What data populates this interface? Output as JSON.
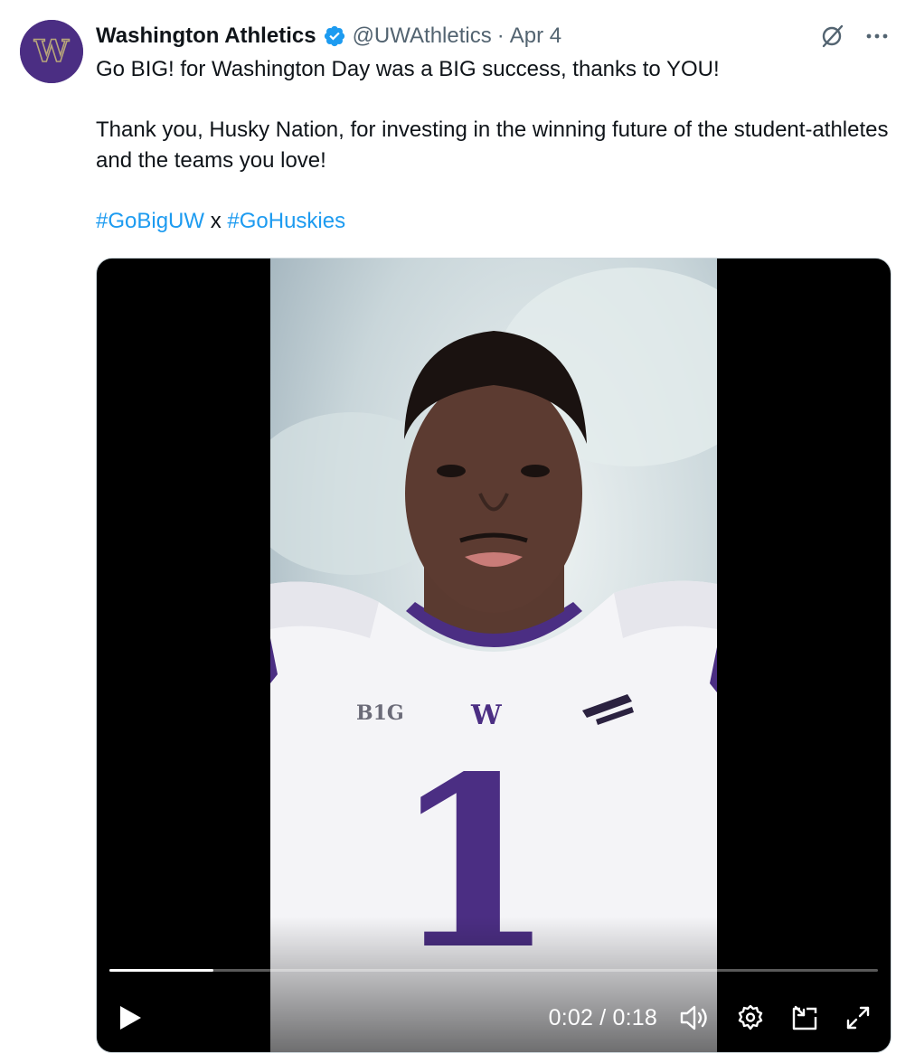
{
  "author": {
    "name": "Washington Athletics",
    "handle": "@UWAthletics",
    "separator": "·",
    "date": "Apr 4",
    "avatar_letter": "W",
    "verified": true,
    "avatar_color": "#4b2e83"
  },
  "tweet": {
    "line1": "Go BIG! for Washington Day was a BIG success, thanks to YOU!",
    "line2": "Thank you, Husky Nation, for investing in the winning future of the student-athletes and the teams you love!",
    "hashtag1": "#GoBigUW",
    "connector": " x ",
    "hashtag2": "#GoHuskies"
  },
  "video": {
    "current_time": "0:02",
    "time_separator": " / ",
    "duration": "0:18",
    "progress_fraction": 0.135,
    "jersey_number": "1",
    "jersey_logo": "W",
    "conference_logo": "B1G"
  },
  "icons": {
    "grok": "grok-icon",
    "more": "more-icon",
    "play": "play-icon",
    "volume": "volume-icon",
    "settings": "settings-icon",
    "pip": "picture-in-picture-icon",
    "fullscreen": "fullscreen-icon",
    "verified": "verified-badge-icon"
  },
  "colors": {
    "link": "#1d9bf0",
    "verified": "#1d9bf0",
    "secondary_text": "#536471",
    "uw_purple": "#4b2e83",
    "uw_gold": "#b7a57a"
  }
}
